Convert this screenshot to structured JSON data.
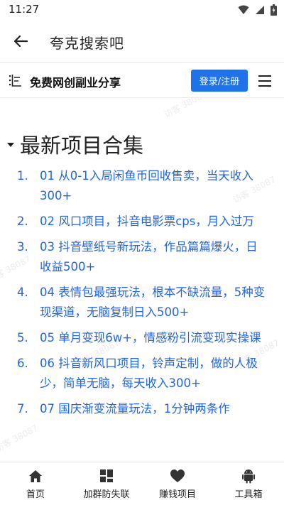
{
  "status_bar": {
    "time": "11:27"
  },
  "app_bar": {
    "title": "夸克搜索吧"
  },
  "site_header": {
    "name": "免费网创副业分享",
    "login_label": "登录/注册"
  },
  "section": {
    "title": "最新项目合集"
  },
  "articles": [
    {
      "num": "1.",
      "text": "01 从0-1入局闲鱼币回收售卖，当天收入300+"
    },
    {
      "num": "2.",
      "text": "02 风口项目，抖音电影票cps，月入过万"
    },
    {
      "num": "3.",
      "text": "03 抖音壁纸号新玩法，作品篇篇爆火，日收益500+"
    },
    {
      "num": "4.",
      "text": "04 表情包最强玩法，根本不缺流量，5种变现渠道，无脑复制日入500+"
    },
    {
      "num": "5.",
      "text": "05 单月变现6w+，情感粉引流变现实操课"
    },
    {
      "num": "6.",
      "text": "06 抖音新风口项目，铃声定制，做的人极少，简单无脑，每天收入300+"
    },
    {
      "num": "7.",
      "text": "07 国庆渐变流量玩法，1分钟两条作"
    }
  ],
  "watermarks": [
    "访客 38087",
    "访客 38087",
    "访客 38087",
    "访客 38087",
    "访客 38087",
    "访客 38087"
  ],
  "bottom_nav": [
    {
      "label": "首页",
      "icon": "home-icon"
    },
    {
      "label": "加群防失联",
      "icon": "grid-icon"
    },
    {
      "label": "赚钱项目",
      "icon": "heart-icon"
    },
    {
      "label": "工具箱",
      "icon": "android-icon"
    }
  ],
  "colors": {
    "accent": "#1f72e8",
    "link": "#2266dd"
  }
}
